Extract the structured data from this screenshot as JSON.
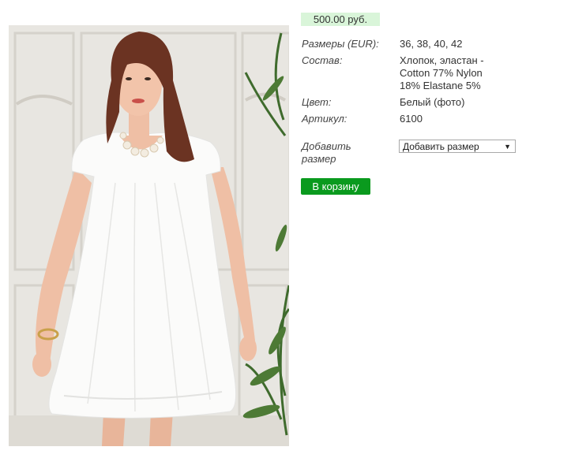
{
  "product": {
    "price": "500.00 руб.",
    "details": [
      {
        "label": "Размеры (EUR):",
        "value": "36, 38, 40, 42"
      },
      {
        "label": "Состав:",
        "value_lines": [
          "Хлопок, эластан -",
          "Cotton 77% Nylon",
          "18% Elastane 5%"
        ]
      },
      {
        "label": "Цвет:",
        "value": "Белый (фото)"
      },
      {
        "label": "Артикул:",
        "value": "6100"
      }
    ],
    "add_size": {
      "label_lines": [
        "Добавить",
        "размер"
      ],
      "selected": "Добавить размер",
      "arrow": "▼"
    },
    "cart_button": "В корзину"
  },
  "colors": {
    "price_bg": "#d9f5d9",
    "button_bg": "#0a9a1e"
  }
}
